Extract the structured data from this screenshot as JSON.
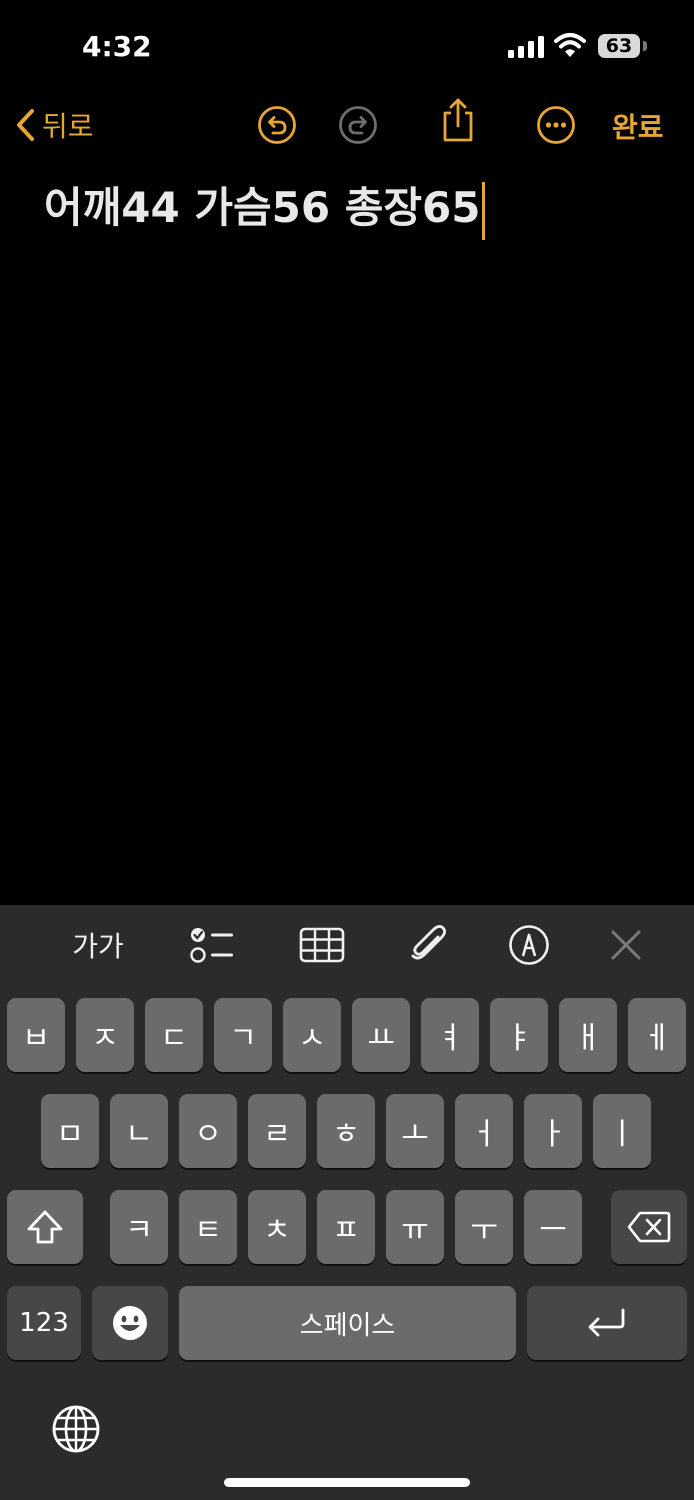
{
  "status_bar": {
    "time": "4:32",
    "battery": "63"
  },
  "nav": {
    "back_label": "뒤로",
    "done_label": "완료"
  },
  "note": {
    "text": "어깨44 가슴56 총장65"
  },
  "toolbar": {
    "text_format_label": "가가"
  },
  "keyboard": {
    "row1": [
      "ㅂ",
      "ㅈ",
      "ㄷ",
      "ㄱ",
      "ㅅ",
      "ㅛ",
      "ㅕ",
      "ㅑ",
      "ㅐ",
      "ㅔ"
    ],
    "row2": [
      "ㅁ",
      "ㄴ",
      "ㅇ",
      "ㄹ",
      "ㅎ",
      "ㅗ",
      "ㅓ",
      "ㅏ",
      "ㅣ"
    ],
    "row3": [
      "ㅋ",
      "ㅌ",
      "ㅊ",
      "ㅍ",
      "ㅠ",
      "ㅜ",
      "ㅡ"
    ],
    "numbers_label": "123",
    "space_label": "스페이스"
  },
  "colors": {
    "accent": "#e5a634",
    "key": "#6b6b6b",
    "key_dark": "#474747",
    "keyboard_bg": "#2b2b2b"
  }
}
